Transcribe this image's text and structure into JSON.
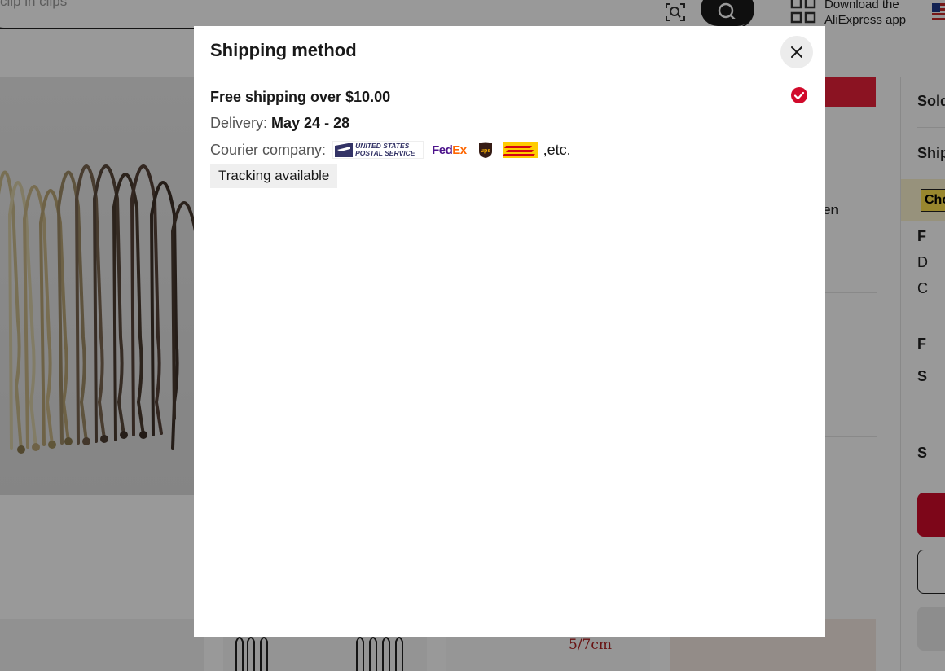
{
  "background": {
    "search_placeholder": "clip in clips",
    "download_app_text_line1": "Download the",
    "download_app_text_line2": "AliExpress app",
    "right_panel": {
      "sold_label": "Sold",
      "ship_label": "Ship",
      "choice_label": "Cho",
      "letter_f1": "F",
      "letter_d": "D",
      "letter_c": "C",
      "letter_f2": "F",
      "letter_s1": "S",
      "letter_s2": "S"
    },
    "partial_text_en": "en",
    "thumb_caption": "5/7cm"
  },
  "modal": {
    "title": "Shipping method",
    "option": {
      "title": "Free shipping over $10.00",
      "delivery_label": "Delivery:",
      "delivery_value": "May 24 - 28",
      "courier_label": "Courier company:",
      "couriers": [
        "USPS",
        "FedEx",
        "UPS",
        "DHL"
      ],
      "usps_line1": "UNITED STATES",
      "usps_line2": "POSTAL SERVICE",
      "fedex_fed": "Fed",
      "fedex_ex": "Ex",
      "ups_text": "ups",
      "courier_suffix": ",etc.",
      "tracking_tag": "Tracking available",
      "selected": true
    }
  },
  "colors": {
    "accent_red": "#e8203a",
    "check_red": "#d10a2b",
    "overlay": "rgba(0,0,0,0.4)",
    "fedex_purple": "#4d148c",
    "fedex_orange": "#ff6600",
    "dhl_yellow": "#ffcc00",
    "dhl_red": "#d40511",
    "ups_brown": "#351c15"
  }
}
